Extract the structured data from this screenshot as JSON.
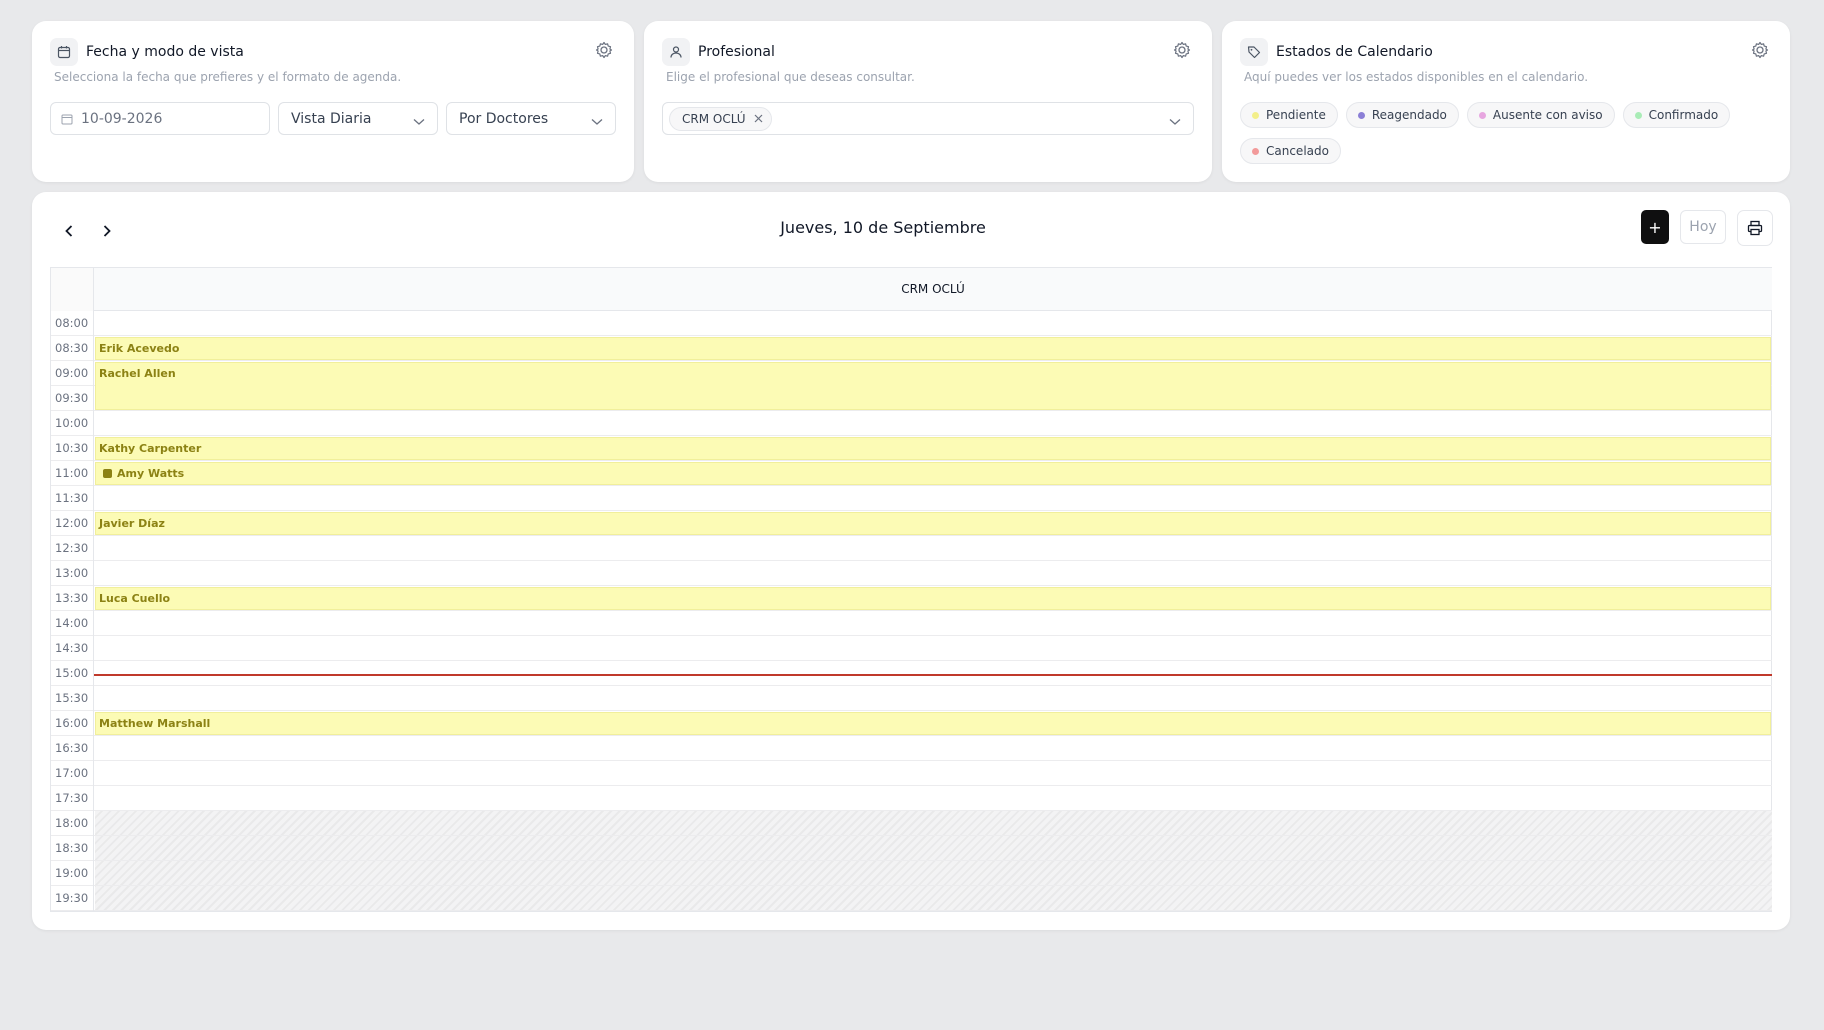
{
  "date_panel": {
    "title": "Fecha y modo de vista",
    "subtitle": "Selecciona la fecha que prefieres y el formato de agenda.",
    "date_value": "10-09-2026",
    "view_mode": "Vista Diaria",
    "group_by": "Por Doctores"
  },
  "professional_panel": {
    "title": "Profesional",
    "subtitle": "Elige el profesional que deseas consultar.",
    "selected_tag": "CRM OCLÚ"
  },
  "status_panel": {
    "title": "Estados de Calendario",
    "subtitle": "Aquí puedes ver los estados disponibles en el calendario.",
    "statuses": [
      {
        "label": "Pendiente",
        "color": "#f3ef8a"
      },
      {
        "label": "Reagendado",
        "color": "#8b7fd6"
      },
      {
        "label": "Ausente con aviso",
        "color": "#e7a6e0"
      },
      {
        "label": "Confirmado",
        "color": "#a9ecb6"
      },
      {
        "label": "Cancelado",
        "color": "#f29a9a"
      }
    ]
  },
  "calendar": {
    "date_title": "Jueves, 10 de Septiembre",
    "add_label": "+",
    "today_label": "Hoy",
    "column_header": "CRM OCLÚ",
    "times": [
      "08:00",
      "08:30",
      "09:00",
      "09:30",
      "10:00",
      "10:30",
      "11:00",
      "11:30",
      "12:00",
      "12:30",
      "13:00",
      "13:30",
      "14:00",
      "14:30",
      "15:00",
      "15:30",
      "16:00",
      "16:30",
      "17:00",
      "17:30",
      "18:00",
      "18:30",
      "19:00",
      "19:30"
    ],
    "appointments": [
      {
        "name": "Erik Acevedo",
        "start": "08:30",
        "slots": 1,
        "note": false
      },
      {
        "name": "Rachel Allen",
        "start": "09:00",
        "slots": 2,
        "note": false
      },
      {
        "name": "Kathy Carpenter",
        "start": "10:30",
        "slots": 1,
        "note": false
      },
      {
        "name": "Amy Watts",
        "start": "11:00",
        "slots": 1,
        "note": true
      },
      {
        "name": "Javier Díaz",
        "start": "12:00",
        "slots": 1,
        "note": false
      },
      {
        "name": "Luca Cuello",
        "start": "13:30",
        "slots": 1,
        "note": false
      },
      {
        "name": "Matthew Marshall",
        "start": "16:00",
        "slots": 1,
        "note": false
      }
    ],
    "current_time": "15:00",
    "off_hours_start": "18:00",
    "accent_color": "#fcfbb5",
    "now_line_color": "#c0392b"
  }
}
